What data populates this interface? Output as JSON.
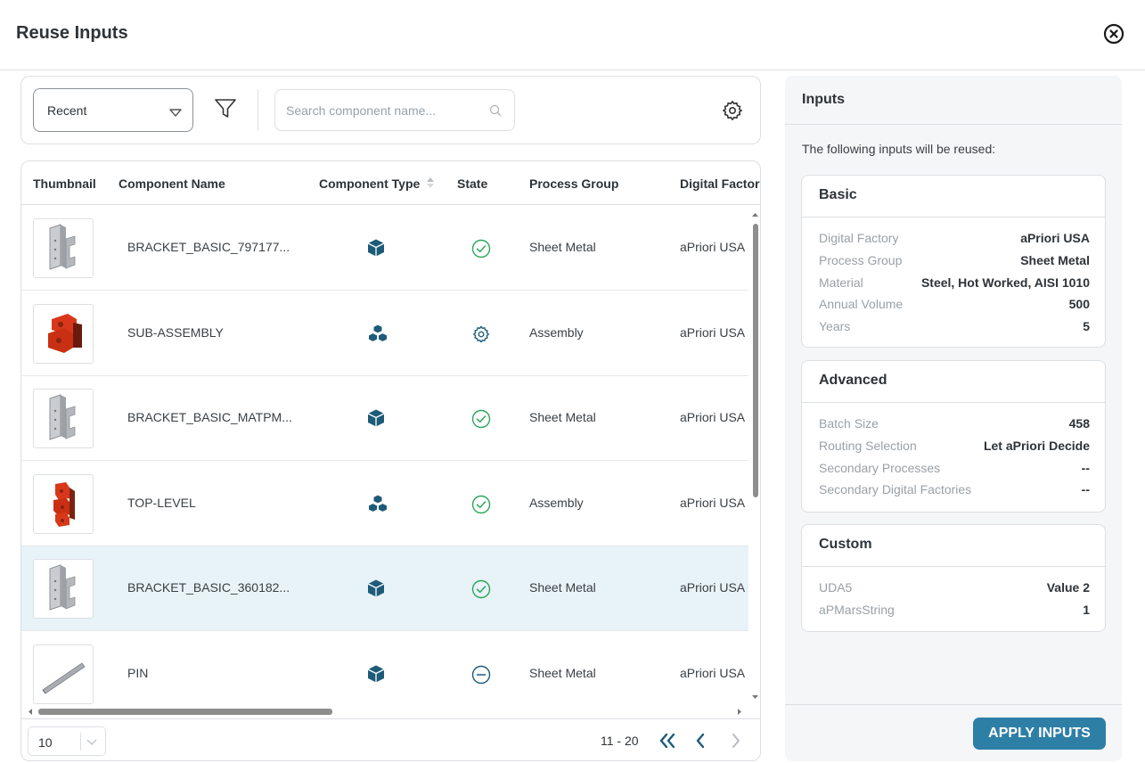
{
  "header": {
    "title": "Reuse Inputs"
  },
  "toolbar": {
    "dropdown_value": "Recent",
    "search_placeholder": "Search component name..."
  },
  "table": {
    "columns": [
      "Thumbnail",
      "Component Name",
      "Component Type",
      "State",
      "Process Group",
      "Digital Factory"
    ],
    "rows": [
      {
        "name": "BRACKET_BASIC_797177...",
        "type": "part",
        "state": "complete",
        "process_group": "Sheet Metal",
        "digital_factory": "aPriori USA",
        "thumb": "bracket"
      },
      {
        "name": "SUB-ASSEMBLY",
        "type": "assembly",
        "state": "processing",
        "process_group": "Assembly",
        "digital_factory": "aPriori USA",
        "thumb": "sub-assembly"
      },
      {
        "name": "BRACKET_BASIC_MATPM...",
        "type": "part",
        "state": "complete",
        "process_group": "Sheet Metal",
        "digital_factory": "aPriori USA",
        "thumb": "bracket"
      },
      {
        "name": "TOP-LEVEL",
        "type": "assembly",
        "state": "complete",
        "process_group": "Assembly",
        "digital_factory": "aPriori USA",
        "thumb": "top-level"
      },
      {
        "name": "BRACKET_BASIC_360182...",
        "type": "part",
        "state": "complete",
        "process_group": "Sheet Metal",
        "digital_factory": "aPriori USA",
        "thumb": "bracket",
        "selected": true
      },
      {
        "name": "PIN",
        "type": "part",
        "state": "not-costed",
        "process_group": "Sheet Metal",
        "digital_factory": "aPriori USA",
        "thumb": "pin"
      }
    ]
  },
  "pagination": {
    "page_size": "10",
    "range": "11 - 20"
  },
  "inputs_panel": {
    "title": "Inputs",
    "intro": "The following inputs will be reused:",
    "basic": {
      "title": "Basic",
      "items": [
        {
          "label": "Digital Factory",
          "value": "aPriori USA"
        },
        {
          "label": "Process Group",
          "value": "Sheet Metal"
        },
        {
          "label": "Material",
          "value": "Steel, Hot Worked, AISI 1010"
        },
        {
          "label": "Annual Volume",
          "value": "500"
        },
        {
          "label": "Years",
          "value": "5"
        }
      ]
    },
    "advanced": {
      "title": "Advanced",
      "items": [
        {
          "label": "Batch Size",
          "value": "458"
        },
        {
          "label": "Routing Selection",
          "value": "Let aPriori Decide"
        },
        {
          "label": "Secondary Processes",
          "value": "--"
        },
        {
          "label": "Secondary Digital Factories",
          "value": "--"
        }
      ]
    },
    "custom": {
      "title": "Custom",
      "items": [
        {
          "label": "UDA5",
          "value": "Value 2"
        },
        {
          "label": "aPMarsString",
          "value": "1"
        }
      ]
    },
    "apply_label": "APPLY INPUTS"
  },
  "colors": {
    "accent": "#2e7fa6",
    "icon_dark": "#1d5b79",
    "status_green": "#2ca55a",
    "selected_row": "#e8f3f8"
  }
}
